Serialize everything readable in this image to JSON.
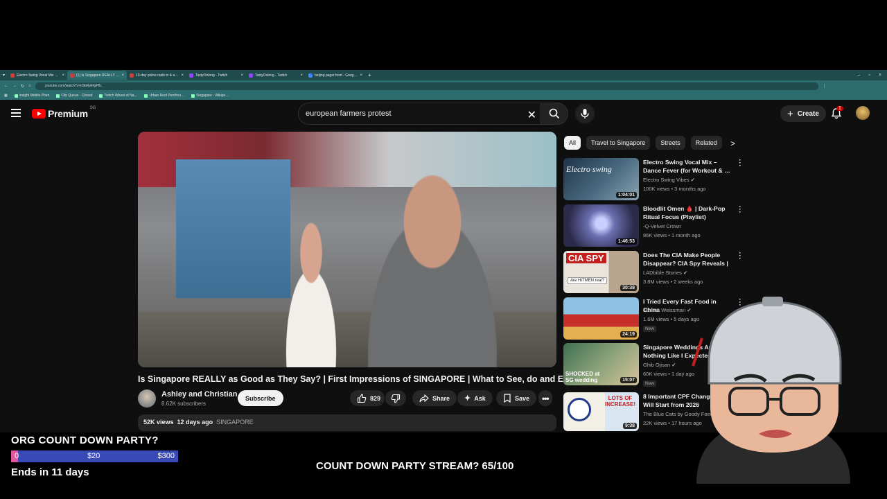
{
  "browser": {
    "tabs": [
      {
        "label": "Electro Swing Vocal Mix – Blo…",
        "color": "#d23b3b"
      },
      {
        "label": "(1) Is Singapore REALLY a…",
        "color": "#d23b3b"
      },
      {
        "label": "10-day police raids in & arou…",
        "color": "#d23b3b"
      },
      {
        "label": "TastyOolong - Twitch",
        "color": "#9146ff"
      },
      {
        "label": "TastyOolong - Twitch",
        "color": "#9146ff"
      },
      {
        "label": "beijing pager food - Google …",
        "color": "#4285f4"
      }
    ],
    "url": "youtube.com/watch?v=nSbRwRgPflc",
    "bookmarks": [
      "insight Mobile Phen",
      "Clip Queue - Closed",
      "Twitch Wheel of Na…",
      "Urban Roof Penthou…",
      "Singapore - Wikipe…"
    ]
  },
  "youtube": {
    "logo_text": "Premium",
    "region": "SG",
    "search_value": "european farmers protest",
    "create_label": "Create",
    "notification_count": "1",
    "video": {
      "title": "Is Singapore REALLY as Good as They Say? | First Impressions of SINGAPORE | What to See, do and Eat",
      "channel": "Ashley and Christian",
      "subscribers": "8.62K subscribers",
      "subscribe_label": "Subscribe",
      "likes": "829",
      "share_label": "Share",
      "ask_label": "Ask",
      "save_label": "Save",
      "views": "52K views",
      "age": "12 days ago",
      "tag": "SINGAPORE"
    },
    "chips": [
      "All",
      "Travel to Singapore",
      "Streets",
      "Related"
    ],
    "recommendations": [
      {
        "title": "Electro Swing Vocal Mix – Dance Fever (for Workout & …",
        "channel": "Electro Swing Vibes",
        "verified": true,
        "meta": "100K views • 3 months ago",
        "duration": "1:04:01",
        "badge": "",
        "colors": [
          "#1e3347",
          "#8aa4b3"
        ]
      },
      {
        "title": "Bloodlit Omen 🩸 | Dark-Pop Ritual Focus (Playlist)",
        "channel": "-Q-Velvet Crown",
        "verified": false,
        "meta": "86K views • 1 month ago",
        "duration": "1:46:53",
        "badge": "",
        "colors": [
          "#2c2a4a",
          "#9aa3d6"
        ]
      },
      {
        "title": "Does The CIA Make People Disappear? CIA Spy Reveals | …",
        "channel": "LADbible Stories",
        "verified": true,
        "meta": "3.8M views • 2 weeks ago",
        "duration": "30:38",
        "badge": "",
        "colors": [
          "#c41f1f",
          "#e9e5dd"
        ]
      },
      {
        "title": "I Tried Every Fast Food in China",
        "channel": "Joshua Weissman",
        "verified": true,
        "meta": "1.6M views • 5 days ago",
        "duration": "24:19",
        "badge": "New",
        "colors": [
          "#8ec3e6",
          "#c7302a"
        ]
      },
      {
        "title": "Singapore Weddings Are Nothing Like I Expected …",
        "channel": "Ghib Ojisan",
        "verified": true,
        "meta": "60K views • 1 day ago",
        "duration": "15:07",
        "badge": "New",
        "colors": [
          "#3f6f4f",
          "#d8c39b"
        ]
      },
      {
        "title": "8 Important CPF Changes That Will Start from 2026",
        "channel": "The Blue Cats by Goody Feed",
        "verified": false,
        "meta": "22K views • 17 hours ago",
        "duration": "9:38",
        "badge": "",
        "colors": [
          "#f2efe6",
          "#1f3a8a"
        ]
      }
    ],
    "thumb_texts": {
      "electro": "Electro swing",
      "cia": "CIA SPY",
      "cia_q": "Are HITMEN real?",
      "wedding": "SHOCKED at SG wedding",
      "cpf": "LOTS OF INCREASE!"
    }
  },
  "overlay": {
    "goal_title": "ORG COUNT DOWN PARTY?",
    "goal_current": "0",
    "goal_mid": "$20",
    "goal_max": "$300",
    "goal_progress": 0.04,
    "goal_end": "Ends in 11 days",
    "countdown": "COUNT DOWN PARTY STREAM? 65/100"
  }
}
